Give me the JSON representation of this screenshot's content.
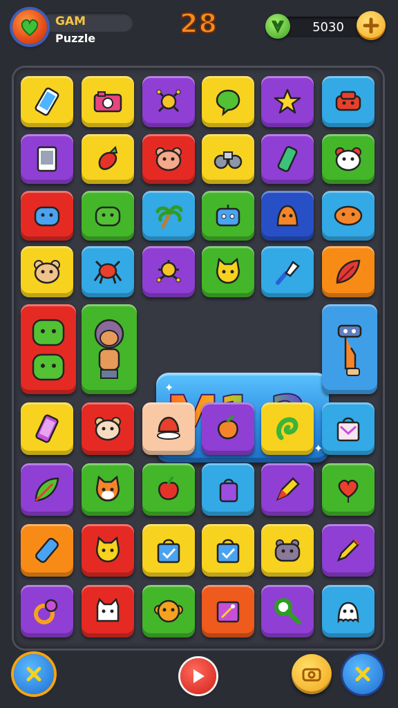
{
  "header": {
    "title": "GAM",
    "subtitle": "Puzzle",
    "level": "28",
    "score": "5030",
    "add_coins_icon": "plus-icon",
    "gem_icon": "gem-icon"
  },
  "banner": {
    "text": "M1 2"
  },
  "colors": {
    "yellow": "#f7d21f",
    "purple": "#8f3fd3",
    "blue": "#33a9e6",
    "green": "#43b62a",
    "red": "#e52a24",
    "orange": "#f88b16",
    "navy": "#2750c7",
    "peach": "#f8c9a4"
  },
  "footer": {
    "left_icon": "close-icon",
    "center_icon": "play-icon",
    "camera_icon": "camera-icon",
    "right_icon": "close-icon"
  }
}
